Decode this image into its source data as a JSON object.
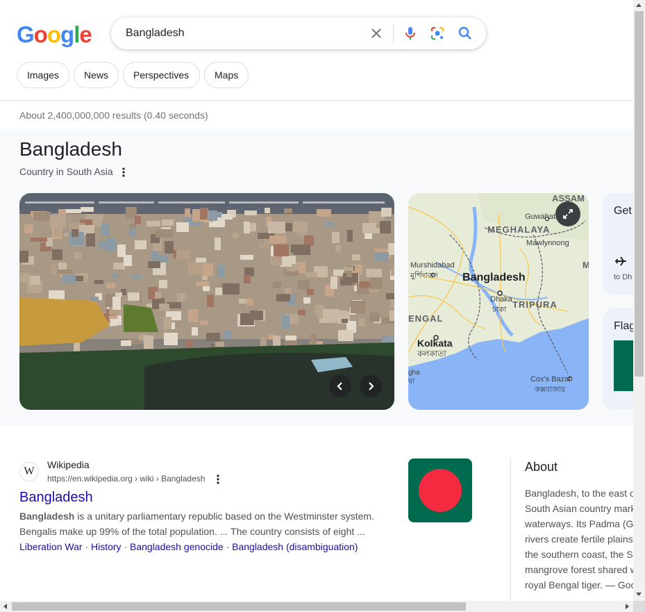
{
  "search": {
    "query": "Bangladesh",
    "logo_letters": [
      {
        "ch": "G",
        "color": "#4285f4"
      },
      {
        "ch": "o",
        "color": "#ea4335"
      },
      {
        "ch": "o",
        "color": "#fbbc05"
      },
      {
        "ch": "g",
        "color": "#4285f4"
      },
      {
        "ch": "l",
        "color": "#34a853"
      },
      {
        "ch": "e",
        "color": "#ea4335"
      }
    ],
    "icons": [
      "clear-icon",
      "microphone-icon",
      "camera-lens-icon",
      "search-icon"
    ]
  },
  "chips": [
    "Images",
    "News",
    "Perspectives",
    "Maps"
  ],
  "stats": "About 2,400,000,000 results (0.40 seconds)",
  "knowledge_panel": {
    "title": "Bangladesh",
    "subtitle": "Country in South Asia",
    "photo_icons": [
      "chevron-left-icon",
      "chevron-right-icon"
    ],
    "map": {
      "labels": {
        "assam": "ASSAM",
        "guwahati": "Guwahati",
        "meghalaya": "MEGHALAYA",
        "mawlynnong": "Mawlynnong",
        "murshidabad": "Murshidabad",
        "murshidabad_bn": "মুর্শিদাবাদ",
        "bangladesh": "Bangladesh",
        "dhaka": "Dhaka",
        "dhaka_bn": "ঢাকা",
        "tripura": "TRIPURA",
        "bengal": "ENGAL",
        "kolkata": "Kolkata",
        "kolkata_bn": "কলকাতা",
        "cox": "Cox's Bazar",
        "cox_bn": "কক্সবাজার",
        "m_edge": "M",
        "gha": "gha",
        "gha_bn": "ঘা"
      },
      "colors": {
        "land": "#e6ecd8",
        "water": "#8ab4f8",
        "border": "#5f6368",
        "road": "#fbc02d"
      }
    },
    "side_cards": {
      "get_label": "Get",
      "flight_text": "to Dh",
      "flag_label": "Flag"
    }
  },
  "result": {
    "favicon": "W",
    "site_name": "Wikipedia",
    "url": "https://en.wikipedia.org › wiki › Bangladesh",
    "title": "Bangladesh",
    "snippet_bold": "Bangladesh",
    "snippet_rest": " is a unitary parliamentary republic based on the Westminster system.",
    "snippet_line2": "Bengalis make up 99% of the total population. ... The country consists of eight ...",
    "sublinks": [
      "Liberation War",
      "History",
      "Bangladesh genocide",
      "Bangladesh (disambiguation)"
    ],
    "flag_colors": {
      "green": "#006a4e",
      "red": "#f42a41"
    }
  },
  "about": {
    "title": "About",
    "lines": [
      "Bangladesh, to the east o",
      "South Asian country mark",
      "waterways. Its Padma (Ga",
      "rivers create fertile plains",
      "the southern coast, the Su",
      "mangrove forest shared w",
      "royal Bengal tiger. — Goo"
    ]
  }
}
